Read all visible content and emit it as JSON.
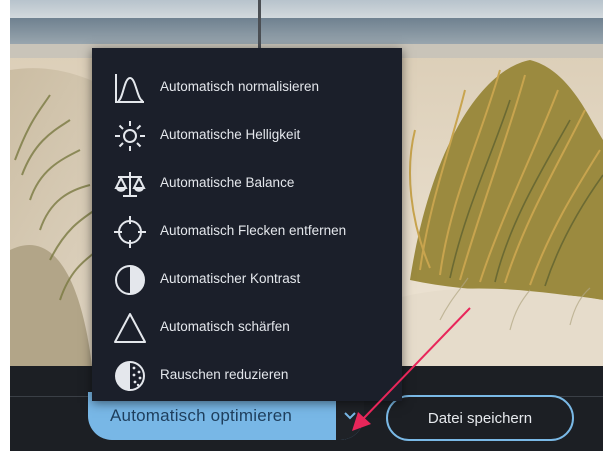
{
  "menu": {
    "items": [
      {
        "label": "Automatisch normalisieren",
        "icon": "bell-curve-icon"
      },
      {
        "label": "Automatische Helligkeit",
        "icon": "sun-icon"
      },
      {
        "label": "Automatische Balance",
        "icon": "scales-icon"
      },
      {
        "label": "Automatisch Flecken entfernen",
        "icon": "crosshair-icon"
      },
      {
        "label": "Automatischer Kontrast",
        "icon": "half-circle-icon"
      },
      {
        "label": "Automatisch schärfen",
        "icon": "triangle-icon"
      },
      {
        "label": "Rauschen reduzieren",
        "icon": "noise-circle-icon"
      }
    ]
  },
  "actions": {
    "optimize_label": "Automatisch optimieren",
    "save_label": "Datei speichern"
  },
  "colors": {
    "menu_background": "#1b1f2a",
    "primary_button": "#78b7e6",
    "outline_button_border": "#7ab9e6",
    "annotation_arrow": "#e8265a"
  }
}
